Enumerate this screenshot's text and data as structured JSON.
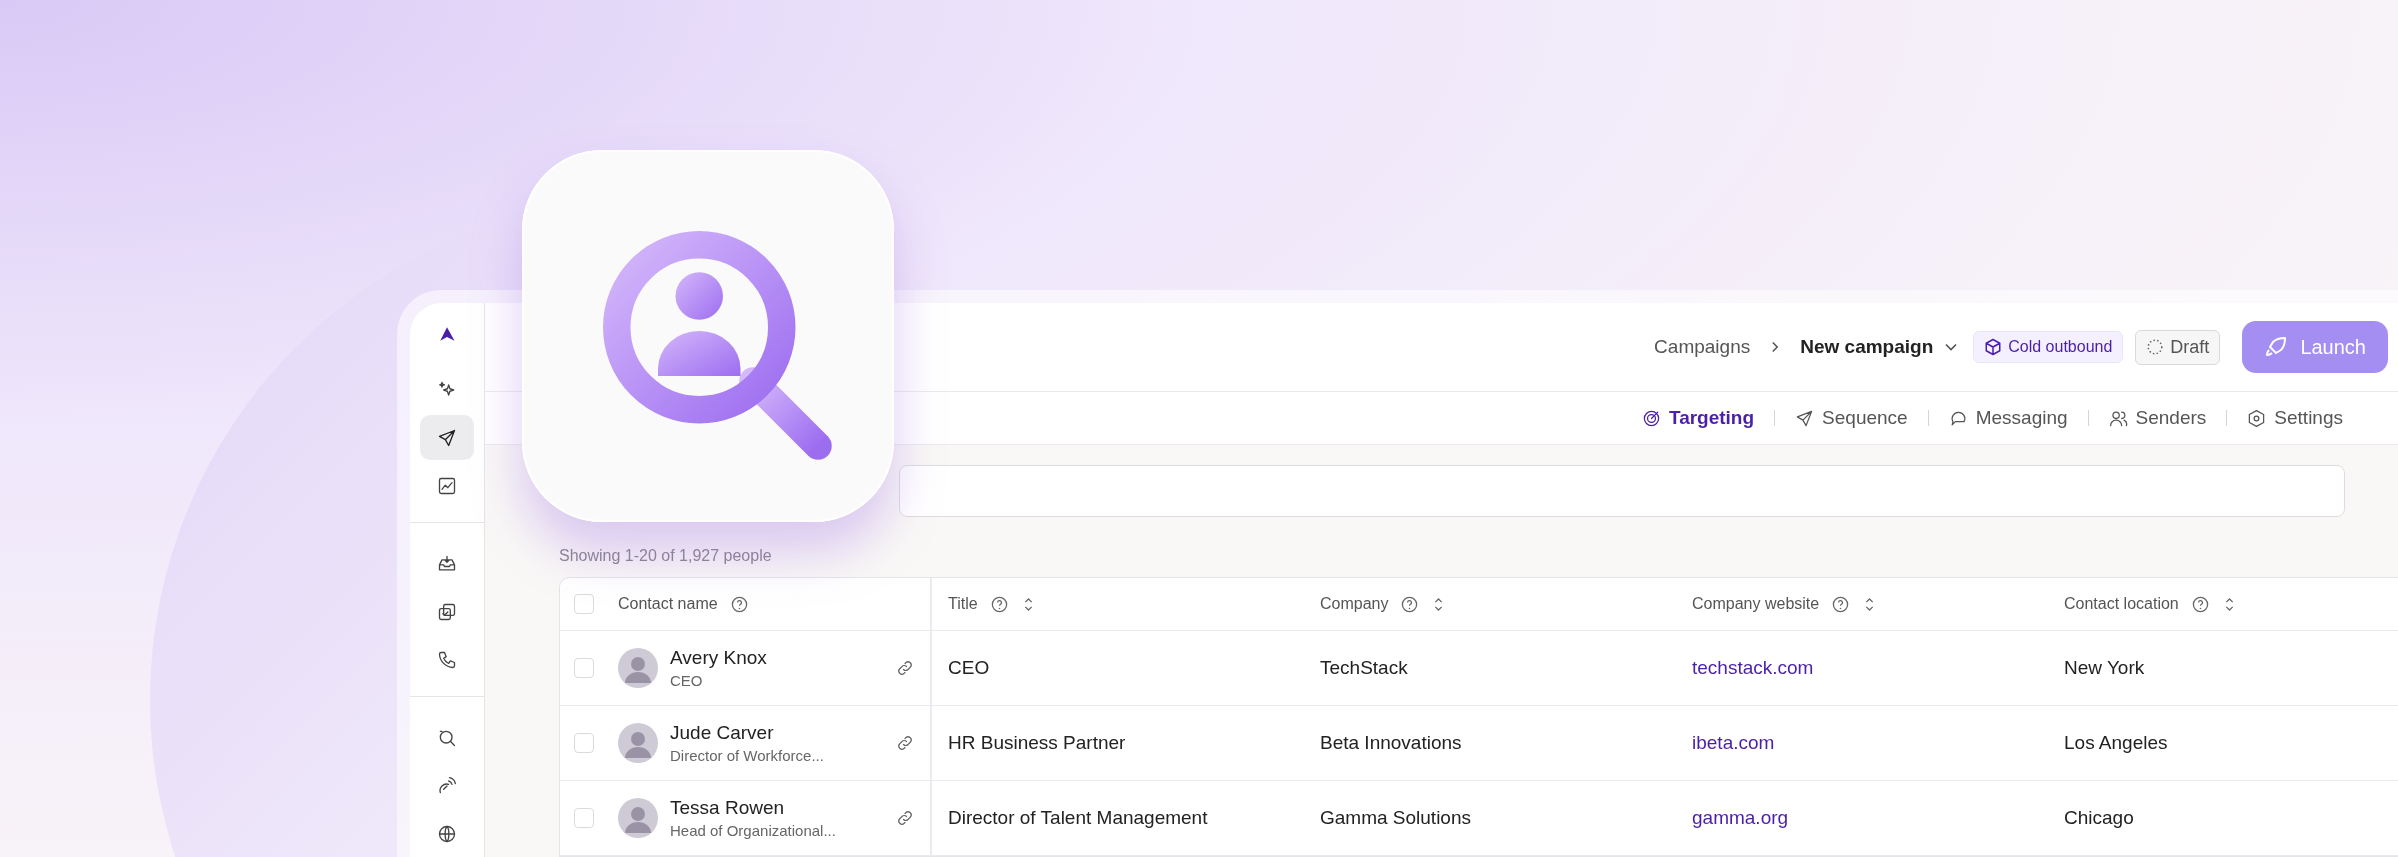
{
  "breadcrumb": {
    "parent": "Campaigns",
    "current": "New campaign"
  },
  "tag": {
    "label": "Cold outbound"
  },
  "status": {
    "label": "Draft"
  },
  "launch": {
    "label": "Launch"
  },
  "sidebar": {
    "groups": [
      [
        {
          "kind": "sparkle",
          "selected": false
        },
        {
          "kind": "send",
          "selected": true
        },
        {
          "kind": "chart",
          "selected": false
        }
      ],
      [
        {
          "kind": "inbox",
          "selected": false
        },
        {
          "kind": "copy",
          "selected": false
        },
        {
          "kind": "phone",
          "selected": false
        }
      ],
      [
        {
          "kind": "search",
          "selected": false
        },
        {
          "kind": "signal",
          "selected": false
        },
        {
          "kind": "globe",
          "selected": false
        }
      ]
    ]
  },
  "tabs": [
    {
      "label": "Targeting",
      "kind": "target",
      "selected": true
    },
    {
      "label": "Sequence",
      "kind": "send",
      "selected": false
    },
    {
      "label": "Messaging",
      "kind": "chat",
      "selected": false
    },
    {
      "label": "Senders",
      "kind": "users",
      "selected": false
    },
    {
      "label": "Settings",
      "kind": "hex",
      "selected": false
    }
  ],
  "result_count": "Showing 1-20 of 1,927 people",
  "table": {
    "all_checked": false,
    "columns": [
      {
        "label": "Contact name",
        "sortable": false
      },
      {
        "label": "Title",
        "sortable": true
      },
      {
        "label": "Company",
        "sortable": true
      },
      {
        "label": "Company website",
        "sortable": true
      },
      {
        "label": "Contact location",
        "sortable": true
      }
    ],
    "rows": [
      {
        "name": "Avery Knox",
        "subtitle": "CEO",
        "title": "CEO",
        "company": "TechStack",
        "website": "techstack.com",
        "location": "New York",
        "checked": false
      },
      {
        "name": "Jude Carver",
        "subtitle": "Director of Workforce...",
        "title": "HR Business Partner",
        "company": "Beta Innovations",
        "website": "ibeta.com",
        "location": "Los Angeles",
        "checked": false
      },
      {
        "name": "Tessa Rowen",
        "subtitle": "Head of Organizational...",
        "title": "Director of Talent Management",
        "company": "Gamma Solutions",
        "website": "gamma.org",
        "location": "Chicago",
        "checked": false
      }
    ]
  }
}
